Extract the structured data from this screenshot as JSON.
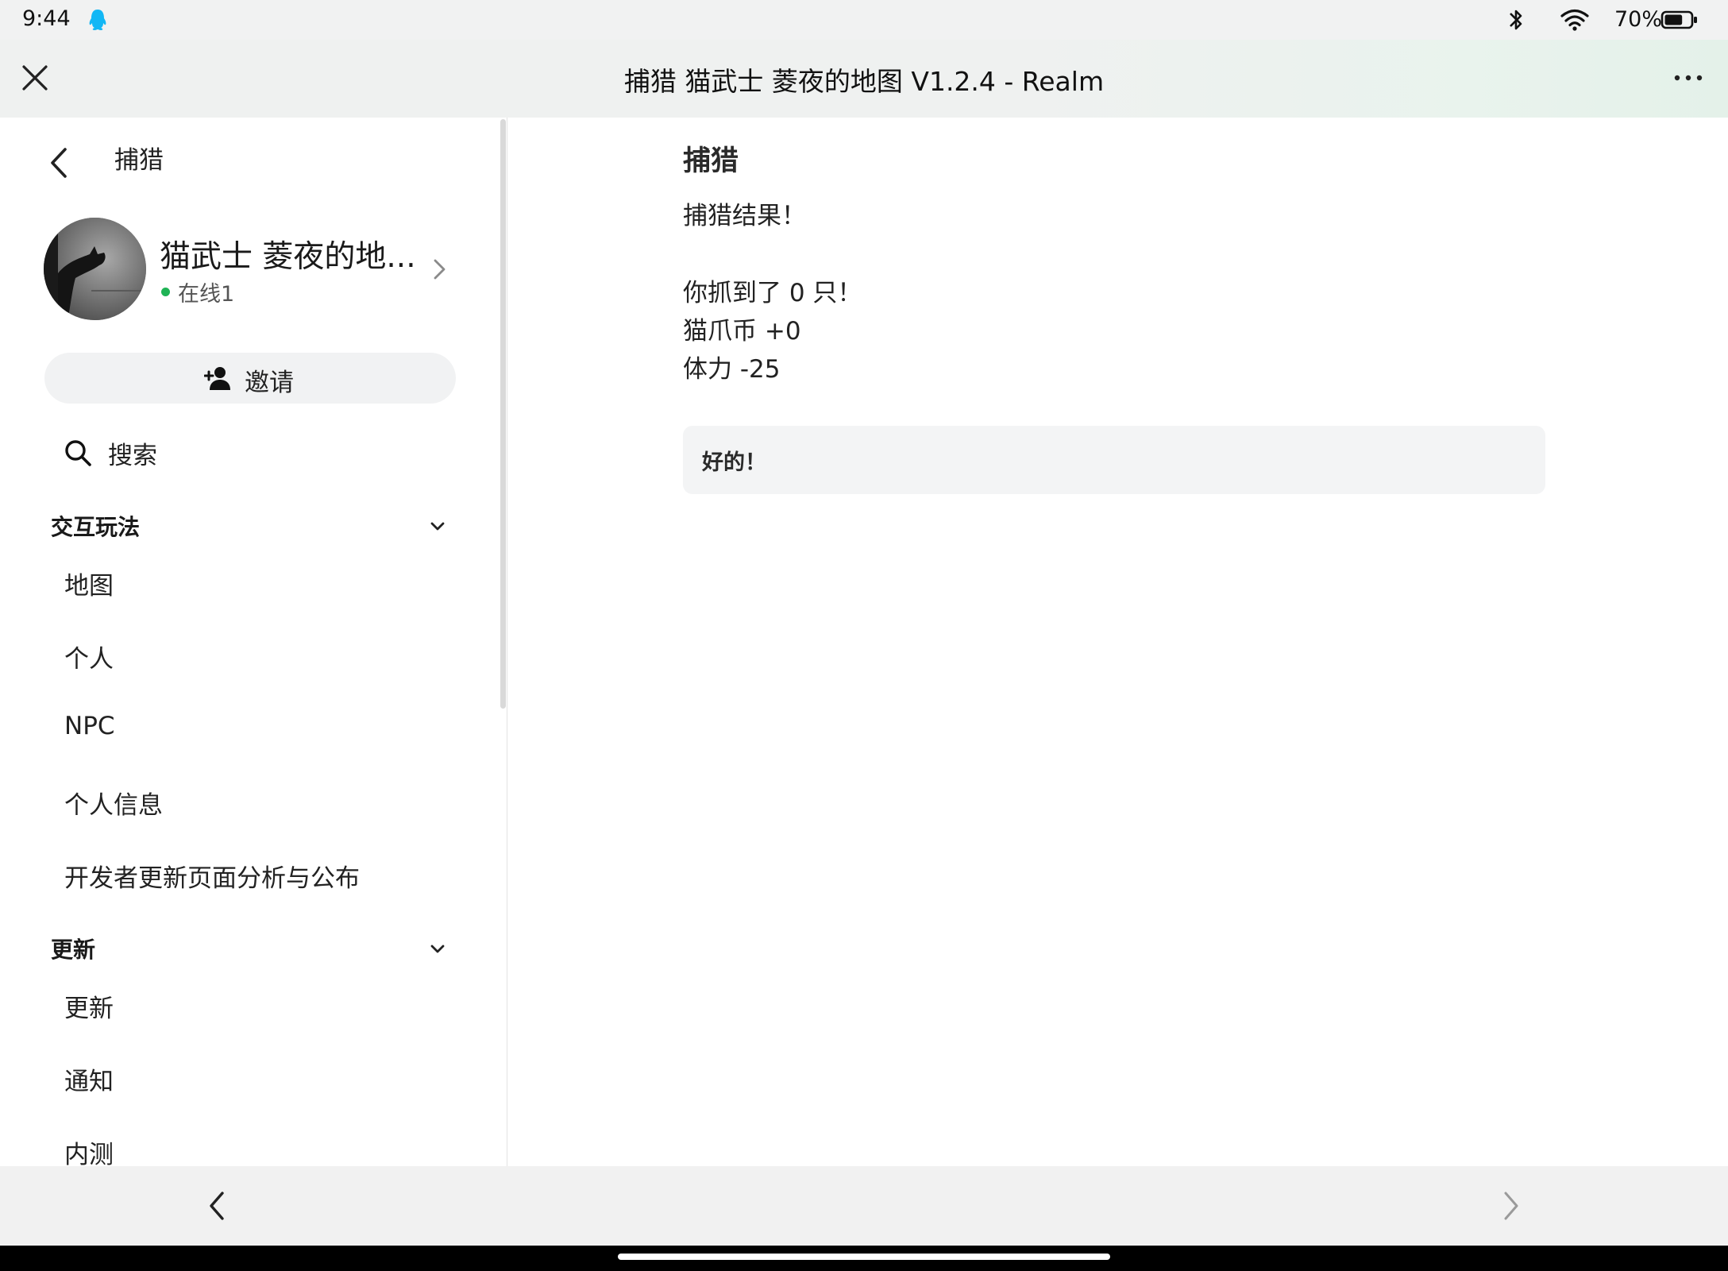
{
  "status_bar": {
    "time": "9:44",
    "battery_percent": "70%",
    "battery_level": 0.7,
    "icons": [
      "qq-icon",
      "bluetooth-icon",
      "wifi-icon",
      "battery-icon"
    ]
  },
  "title_bar": {
    "title": "捕猎 猫武士 菱夜的地图 V1.2.4 - Realm",
    "close_icon": "close-icon",
    "more_icon": "more-icon"
  },
  "sidebar": {
    "header_title": "捕猎",
    "guild": {
      "name": "猫武士 菱夜的地...",
      "online": "在线1",
      "online_color": "#1fb355"
    },
    "invite_label": "邀请",
    "search_label": "搜索",
    "sections": [
      {
        "title": "交互玩法",
        "items": [
          "地图",
          "个人",
          "NPC",
          "个人信息",
          "开发者更新页面分析与公布"
        ]
      },
      {
        "title": "更新",
        "items": [
          "更新",
          "通知",
          "内测"
        ]
      }
    ]
  },
  "content": {
    "title": "捕猎",
    "lines": [
      "捕猎结果！",
      "你抓到了 0 只！",
      "猫爪币 +0",
      "体力 -25"
    ],
    "ok_button": "好的！"
  },
  "colors": {
    "accent_online": "#1fb355",
    "qq_blue": "#12b7f5"
  }
}
